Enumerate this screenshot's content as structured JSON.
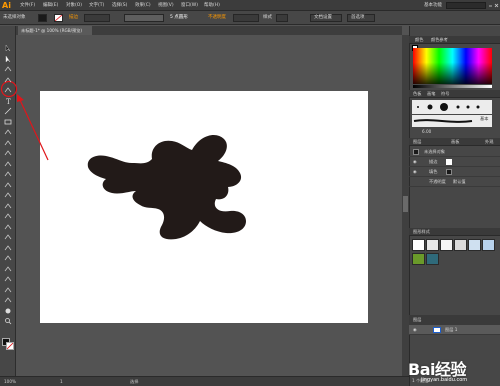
{
  "app": {
    "logo": "Ai"
  },
  "menu": {
    "items": [
      "文件(F)",
      "编辑(E)",
      "对象(O)",
      "文字(T)",
      "选择(S)",
      "效果(C)",
      "视图(V)",
      "窗口(W)",
      "帮助(H)"
    ],
    "workspace": "基本功能"
  },
  "control_bar": {
    "selection_label": "未选择对象",
    "stroke_label": "描边",
    "opacity_label": "不透明度",
    "style_label": "样式",
    "doc_setup": "文档设置",
    "preferences": "首选项",
    "point_label": "5 点圆形",
    "accent": "#ff9a00"
  },
  "document": {
    "tab_title": "未标题-1* @ 100% (RGB/预览)"
  },
  "panels": {
    "color_tabs": [
      "颜色",
      "颜色参考"
    ],
    "brush_tabs": [
      "色板",
      "画笔",
      "符号"
    ],
    "stroke_label": "基本",
    "stroke_value": "6.00",
    "layers_tabs": [
      "图层",
      "画板",
      "外观"
    ],
    "appearance_title": "未选择对象",
    "appearance_rows": [
      "描边",
      "填色"
    ],
    "opacity_row": "不透明度",
    "opacity_value": "默认值",
    "graphic_styles_title": "图形样式",
    "layer_name": "图层 1",
    "layer_count": "1 个图层"
  },
  "status": {
    "zoom": "100%",
    "page": "1",
    "tool": "选择"
  },
  "watermark": {
    "logo": "Bai经验",
    "url": "jingyan.baidu.com"
  },
  "colors": {
    "artwork": "#221a18",
    "highlight": "#e0161b"
  },
  "icons": [
    "select-icon",
    "direct-select-icon",
    "magic-wand-icon",
    "lasso-icon",
    "pen-icon",
    "type-icon",
    "line-icon",
    "rect-icon",
    "paintbrush-icon",
    "pencil-icon",
    "eraser-icon",
    "rotate-icon",
    "scale-icon",
    "width-icon",
    "free-transform-icon",
    "shape-builder-icon",
    "perspective-icon",
    "mesh-icon",
    "gradient-icon",
    "eyedropper-icon",
    "blend-icon",
    "symbol-sprayer-icon",
    "column-graph-icon",
    "artboard-icon",
    "slice-icon",
    "hand-icon",
    "zoom-icon"
  ]
}
